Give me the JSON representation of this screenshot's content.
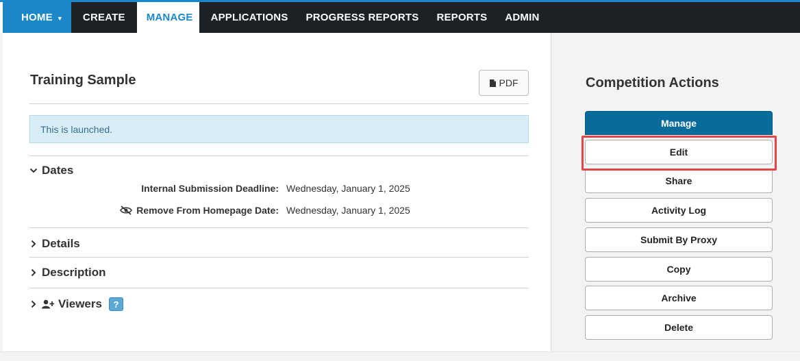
{
  "nav": {
    "home": "HOME",
    "create": "CREATE",
    "manage": "MANAGE",
    "applications": "APPLICATIONS",
    "progress_reports": "PROGRESS REPORTS",
    "reports": "REPORTS",
    "admin": "ADMIN"
  },
  "main": {
    "title": "Training Sample",
    "pdf_label": "PDF",
    "alert": "This is launched.",
    "dates": {
      "header": "Dates",
      "fields": [
        {
          "label": "Internal Submission Deadline:",
          "value": "Wednesday, January 1, 2025"
        },
        {
          "label": "Remove From Homepage Date:",
          "value": "Wednesday, January 1, 2025"
        }
      ]
    },
    "details_header": "Details",
    "description_header": "Description",
    "viewers_header": "Viewers",
    "help_badge": "?"
  },
  "side": {
    "title": "Competition Actions",
    "buttons": [
      "Manage",
      "Edit",
      "Share",
      "Activity Log",
      "Submit By Proxy",
      "Copy",
      "Archive",
      "Delete"
    ]
  },
  "colors": {
    "nav_bg": "#1b2125",
    "accent": "#1a87c9",
    "primary_button": "#076b9c",
    "alert_bg": "#d9edf7",
    "highlight": "#e54547"
  }
}
